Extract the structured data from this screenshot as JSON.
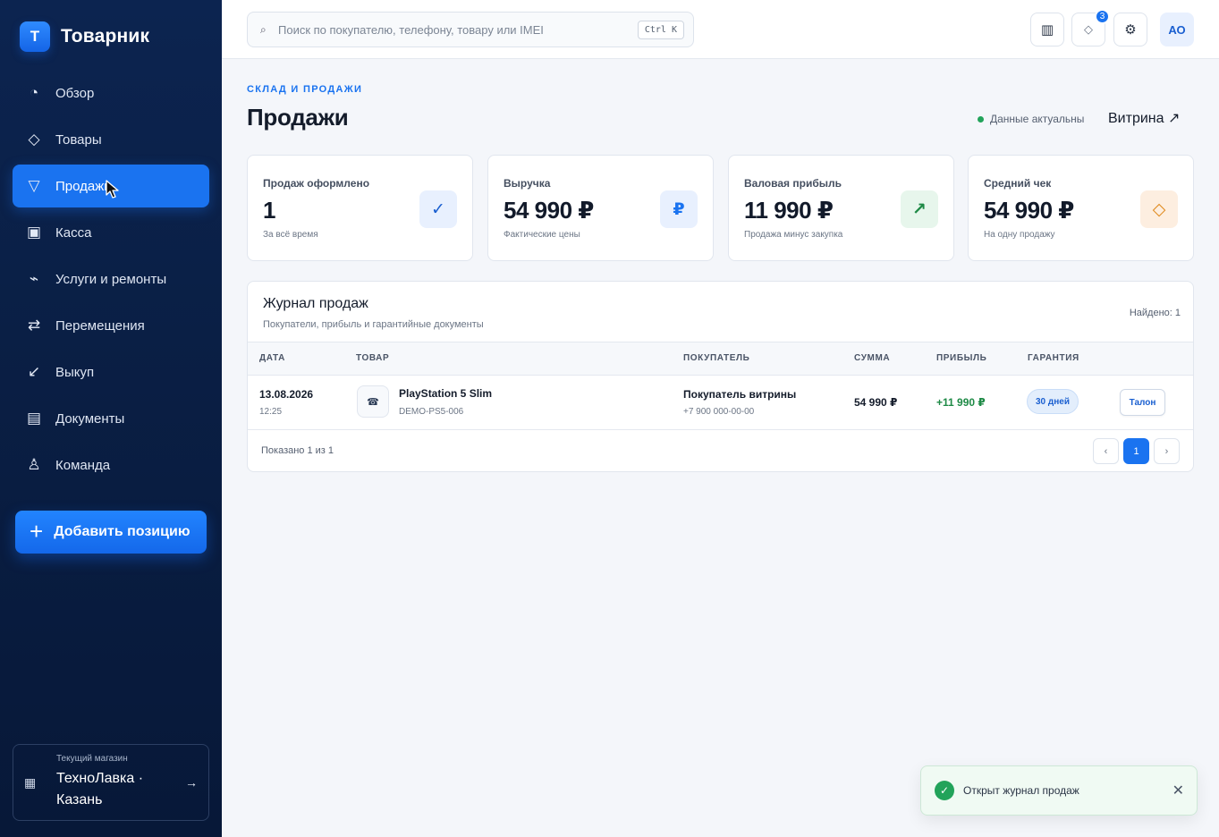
{
  "sidebar": {
    "brand": {
      "logo_letter": "Т",
      "name": "Товарник"
    },
    "items": [
      {
        "label": "Обзор",
        "icon": "pie-chart-icon",
        "glyph": "◔"
      },
      {
        "label": "Товары",
        "icon": "diamond-icon",
        "glyph": "◇"
      },
      {
        "label": "Продажи",
        "icon": "funnel-icon",
        "glyph": "▽",
        "active": true
      },
      {
        "label": "Касса",
        "icon": "cash-register-icon",
        "glyph": "▣"
      },
      {
        "label": "Услуги и ремонты",
        "icon": "wrench-icon",
        "glyph": "⌁"
      },
      {
        "label": "Перемещения",
        "icon": "transfer-arrows-icon",
        "glyph": "⇄"
      },
      {
        "label": "Выкуп",
        "icon": "buyback-arrow-icon",
        "glyph": "↙"
      },
      {
        "label": "Документы",
        "icon": "documents-icon",
        "glyph": "▤"
      },
      {
        "label": "Команда",
        "icon": "team-user-icon",
        "glyph": "♙"
      }
    ],
    "add_button": {
      "icon": "plus-icon",
      "label": "Добавить позицию"
    },
    "store": {
      "label": "Текущий магазин",
      "name": "ТехноЛавка · Казань",
      "icon": "building-icon",
      "arrow_icon": "arrow-right-icon"
    }
  },
  "topbar": {
    "search": {
      "placeholder": "Поиск по покупателю, телефону, товару или IMEI",
      "value": "",
      "shortcut": "Ctrl K",
      "icon": "search-icon"
    },
    "notifications_count": "3",
    "avatar_initials": "АО"
  },
  "header": {
    "eyebrow": "СКЛАД И ПРОДАЖИ",
    "title": "Продажи",
    "status": "Данные актуальны",
    "showcase_link": "Витрина ↗"
  },
  "stats": [
    {
      "label": "Продаж оформлено",
      "value": "1",
      "sub": "За всё время",
      "icon": "check-icon",
      "glyph": "✓",
      "icon_bg": "#e8f0fe",
      "icon_color": "#1a5fd0"
    },
    {
      "label": "Выручка",
      "value": "54 990 ₽",
      "sub": "Фактические цены",
      "icon": "ruble-icon",
      "glyph": "₽",
      "icon_bg": "#e8f0fe",
      "icon_color": "#1a73f0"
    },
    {
      "label": "Валовая прибыль",
      "value": "11 990 ₽",
      "sub": "Продажа минус закупка",
      "icon": "trend-up-icon",
      "glyph": "↗",
      "icon_bg": "#e7f6ec",
      "icon_color": "#1e8a46"
    },
    {
      "label": "Средний чек",
      "value": "54 990 ₽",
      "sub": "На одну продажу",
      "icon": "diamond-icon",
      "glyph": "◇",
      "icon_bg": "#fdeee0",
      "icon_color": "#e08a1e"
    }
  ],
  "journal": {
    "title": "Журнал продаж",
    "subtitle": "Покупатели, прибыль и гарантийные документы",
    "found": "Найдено: 1",
    "columns": [
      "ДАТА",
      "ТОВАР",
      "ПОКУПАТЕЛЬ",
      "СУММА",
      "ПРИБЫЛЬ",
      "ГАРАНТИЯ"
    ],
    "rows": [
      {
        "date": "13.08.2026",
        "time": "12:25",
        "product_icon": "phone-icon",
        "product_glyph": "☎",
        "product": "PlayStation 5 Slim",
        "sku": "DEMO-PS5-006",
        "buyer": "Покупатель витрины",
        "phone": "+7 900 000-00-00",
        "amount": "54 990 ₽",
        "profit": "+11 990 ₽",
        "warranty": "30 дней",
        "action": "Талон"
      }
    ],
    "shown": "Показано 1 из 1",
    "pagination": {
      "prev": "‹",
      "page": "1",
      "next": "›"
    }
  },
  "toast": {
    "text": "Открыт журнал продаж",
    "icon": "check-circle-icon",
    "close_icon": "close-icon"
  },
  "colors": {
    "accent": "#1a73f0",
    "sidebar_bg": "#0a1f45",
    "success": "#22a35a"
  }
}
